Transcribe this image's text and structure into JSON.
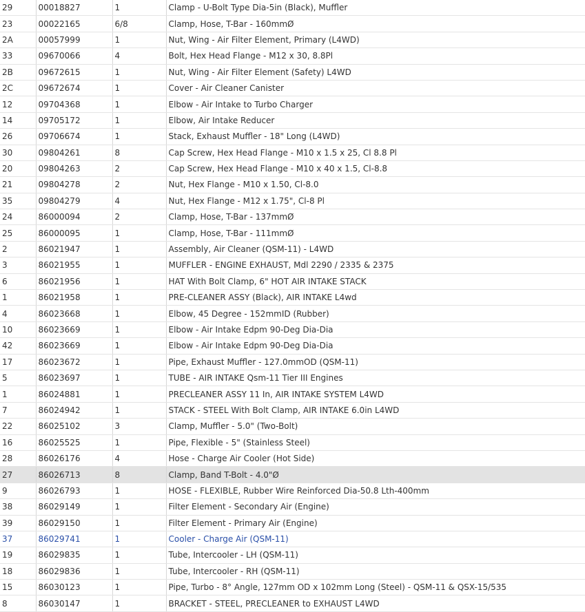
{
  "parts_table": {
    "rows": [
      {
        "ref": "29",
        "part": "00018827",
        "qty": "1",
        "desc": "Clamp - U-Bolt Type Dia-5in (Black), Muffler"
      },
      {
        "ref": "23",
        "part": "00022165",
        "qty": "6/8",
        "desc": "Clamp, Hose, T-Bar - 160mmØ"
      },
      {
        "ref": "2A",
        "part": "00057999",
        "qty": "1",
        "desc": "Nut, Wing - Air Filter Element, Primary (L4WD)"
      },
      {
        "ref": "33",
        "part": "09670066",
        "qty": "4",
        "desc": "Bolt, Hex Head Flange - M12 x 30, 8.8Pl"
      },
      {
        "ref": "2B",
        "part": "09672615",
        "qty": "1",
        "desc": "Nut, Wing - Air Filter Element (Safety) L4WD"
      },
      {
        "ref": "2C",
        "part": "09672674",
        "qty": "1",
        "desc": "Cover - Air Cleaner Canister"
      },
      {
        "ref": "12",
        "part": "09704368",
        "qty": "1",
        "desc": "Elbow - Air Intake to Turbo Charger"
      },
      {
        "ref": "14",
        "part": "09705172",
        "qty": "1",
        "desc": "Elbow, Air Intake Reducer"
      },
      {
        "ref": "26",
        "part": "09706674",
        "qty": "1",
        "desc": "Stack, Exhaust Muffler - 18\" Long (L4WD)"
      },
      {
        "ref": "30",
        "part": "09804261",
        "qty": "8",
        "desc": "Cap Screw, Hex Head Flange - M10 x 1.5 x 25, Cl 8.8 Pl"
      },
      {
        "ref": "20",
        "part": "09804263",
        "qty": "2",
        "desc": "Cap Screw, Hex Head Flange - M10 x 40 x 1.5, Cl-8.8"
      },
      {
        "ref": "21",
        "part": "09804278",
        "qty": "2",
        "desc": "Nut, Hex Flange - M10 x 1.50, Cl-8.0"
      },
      {
        "ref": "35",
        "part": "09804279",
        "qty": "4",
        "desc": "Nut, Hex Flange - M12 x 1.75\", Cl-8 Pl"
      },
      {
        "ref": "24",
        "part": "86000094",
        "qty": "2",
        "desc": "Clamp, Hose, T-Bar - 137mmØ"
      },
      {
        "ref": "25",
        "part": "86000095",
        "qty": "1",
        "desc": "Clamp, Hose, T-Bar - 111mmØ"
      },
      {
        "ref": "2",
        "part": "86021947",
        "qty": "1",
        "desc": "Assembly, Air Cleaner (QSM-11) - L4WD"
      },
      {
        "ref": "3",
        "part": "86021955",
        "qty": "1",
        "desc": "MUFFLER - ENGINE EXHAUST, Mdl 2290 / 2335 & 2375"
      },
      {
        "ref": "6",
        "part": "86021956",
        "qty": "1",
        "desc": "HAT With Bolt Clamp, 6\" HOT AIR INTAKE STACK"
      },
      {
        "ref": "1",
        "part": "86021958",
        "qty": "1",
        "desc": "PRE-CLEANER ASSY (Black), AIR INTAKE L4wd"
      },
      {
        "ref": "4",
        "part": "86023668",
        "qty": "1",
        "desc": "Elbow, 45 Degree - 152mmID (Rubber)"
      },
      {
        "ref": "10",
        "part": "86023669",
        "qty": "1",
        "desc": "Elbow - Air Intake Edpm 90-Deg Dia-Dia"
      },
      {
        "ref": "42",
        "part": "86023669",
        "qty": "1",
        "desc": "Elbow - Air Intake Edpm 90-Deg Dia-Dia"
      },
      {
        "ref": "17",
        "part": "86023672",
        "qty": "1",
        "desc": "Pipe, Exhaust Muffler - 127.0mmOD (QSM-11)"
      },
      {
        "ref": "5",
        "part": "86023697",
        "qty": "1",
        "desc": "TUBE - AIR INTAKE Qsm-11 Tier III Engines"
      },
      {
        "ref": "1",
        "part": "86024881",
        "qty": "1",
        "desc": "PRECLEANER ASSY 11 In, AIR INTAKE SYSTEM L4WD"
      },
      {
        "ref": "7",
        "part": "86024942",
        "qty": "1",
        "desc": "STACK - STEEL With Bolt Clamp, AIR INTAKE 6.0in L4WD"
      },
      {
        "ref": "22",
        "part": "86025102",
        "qty": "3",
        "desc": "Clamp, Muffler - 5.0\" (Two-Bolt)"
      },
      {
        "ref": "16",
        "part": "86025525",
        "qty": "1",
        "desc": "Pipe, Flexible - 5\" (Stainless Steel)"
      },
      {
        "ref": "28",
        "part": "86026176",
        "qty": "4",
        "desc": "Hose - Charge Air Cooler (Hot Side)"
      },
      {
        "ref": "27",
        "part": "86026713",
        "qty": "8",
        "desc": "Clamp, Band T-Bolt - 4.0\"Ø",
        "state": "hover"
      },
      {
        "ref": "9",
        "part": "86026793",
        "qty": "1",
        "desc": "HOSE - FLEXIBLE, Rubber Wire Reinforced Dia-50.8 Lth-400mm"
      },
      {
        "ref": "38",
        "part": "86029149",
        "qty": "1",
        "desc": "Filter Element - Secondary Air (Engine)"
      },
      {
        "ref": "39",
        "part": "86029150",
        "qty": "1",
        "desc": "Filter Element - Primary Air (Engine)"
      },
      {
        "ref": "37",
        "part": "86029741",
        "qty": "1",
        "desc": "Cooler - Charge Air (QSM-11)",
        "state": "link"
      },
      {
        "ref": "19",
        "part": "86029835",
        "qty": "1",
        "desc": "Tube, Intercooler - LH (QSM-11)"
      },
      {
        "ref": "18",
        "part": "86029836",
        "qty": "1",
        "desc": "Tube, Intercooler - RH (QSM-11)"
      },
      {
        "ref": "15",
        "part": "86030123",
        "qty": "1",
        "desc": "Pipe, Turbo - 8° Angle, 127mm OD x 102mm Long (Steel) - QSM-11 & QSX-15/535"
      },
      {
        "ref": "8",
        "part": "86030147",
        "qty": "1",
        "desc": "BRACKET - STEEL, PRECLEANER to EXHAUST L4WD"
      }
    ]
  },
  "colors": {
    "text": "#333333",
    "link": "#2a4fa8",
    "hover_row": "#e3e3e3",
    "grid": "#d7d7d7"
  }
}
